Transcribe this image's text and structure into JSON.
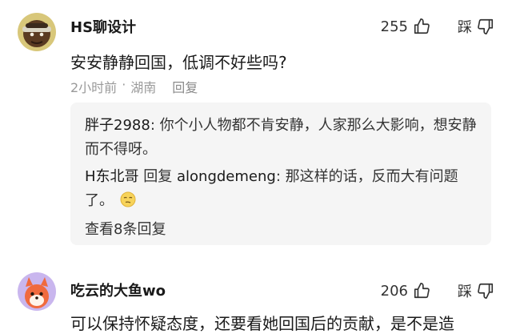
{
  "comments": [
    {
      "username": "HS聊设计",
      "likes": "255",
      "dislike_label": "踩",
      "text": "安安静静回国，低调不好些吗?",
      "time": "2小时前",
      "separator": "·",
      "location": "湖南",
      "reply_label": "回复",
      "replies": [
        {
          "author": "胖子2988",
          "text": ": 你个小人物都不肯安静，人家那么大影响，想安静而不得呀。"
        },
        {
          "author": "H东北哥",
          "reply_word": " 回复 ",
          "target": "alongdemeng",
          "text": ": 那这样的话，反而大有问题了。",
          "emoji": "smirk-emoji"
        }
      ],
      "more_replies": "查看8条回复"
    },
    {
      "username": "吃云的大鱼wo",
      "likes": "206",
      "dislike_label": "踩",
      "text": "可以保持怀疑态度，还要看她回国后的贡献，是不是造"
    }
  ],
  "colors": {
    "meta": "#9a9a9a",
    "reply_bg": "#f5f5f5",
    "text": "#1a1a1a"
  }
}
